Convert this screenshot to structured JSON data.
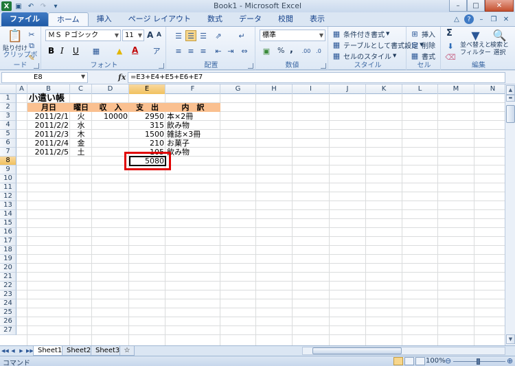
{
  "window": {
    "title": "Book1 - Microsoft Excel",
    "app_icon": "excel-icon",
    "controls": [
      "minimize-icon",
      "maximize-icon",
      "close-icon"
    ]
  },
  "quick_access": [
    "save-icon",
    "undo-icon",
    "redo-icon",
    "customize-qat-icon"
  ],
  "ribbon_tabs": [
    "ファイル",
    "ホーム",
    "挿入",
    "ページ レイアウト",
    "数式",
    "データ",
    "校閲",
    "表示"
  ],
  "active_tab": "ホーム",
  "ribbon": {
    "clipboard": {
      "label": "クリップボード",
      "paste": "貼り付け"
    },
    "font": {
      "label": "フォント",
      "font_name": "ＭＳ Ｐゴシック",
      "font_size": "11",
      "grow": "A",
      "shrink": "A",
      "bold": "B",
      "italic": "I",
      "underline": "U",
      "color_a": "A"
    },
    "alignment": {
      "label": "配置"
    },
    "number": {
      "label": "数値",
      "format": "標準",
      "percent": "%",
      "comma": ","
    },
    "styles": {
      "label": "スタイル",
      "conditional": "条件付き書式",
      "as_table": "テーブルとして書式設定",
      "cell_styles": "セルのスタイル"
    },
    "cells": {
      "label": "セル",
      "insert": "挿入",
      "delete": "削除",
      "format": "書式"
    },
    "editing": {
      "label": "編集",
      "sigma": "Σ",
      "sort_filter_1": "並べ替えと",
      "sort_filter_2": "フィルター",
      "find_1": "検索と",
      "find_2": "選択"
    }
  },
  "formula_bar": {
    "name_box": "E8",
    "fx": "fx",
    "formula": "=E3+E4+E5+E6+E7"
  },
  "columns": [
    "A",
    "B",
    "C",
    "D",
    "E",
    "F",
    "G",
    "H",
    "I",
    "J",
    "K",
    "L",
    "M",
    "N"
  ],
  "selected_column": "E",
  "rows": [
    "1",
    "2",
    "3",
    "4",
    "5",
    "6",
    "7",
    "8",
    "9",
    "10",
    "11",
    "12",
    "13",
    "14",
    "15",
    "16",
    "17",
    "18",
    "19",
    "20",
    "21",
    "22",
    "23",
    "24",
    "25",
    "26",
    "27"
  ],
  "selected_row": "8",
  "sheet": {
    "title": "小遣い帳",
    "headers": [
      "月日",
      "曜日",
      "収　入",
      "支　出",
      "内　訳"
    ],
    "rows": [
      {
        "date": "2011/2/1",
        "day": "火",
        "income": "10000",
        "expense": "2950",
        "detail": "本×2冊"
      },
      {
        "date": "2011/2/2",
        "day": "水",
        "income": "",
        "expense": "315",
        "detail": "飲み物"
      },
      {
        "date": "2011/2/3",
        "day": "木",
        "income": "",
        "expense": "1500",
        "detail": "雑誌×3冊"
      },
      {
        "date": "2011/2/4",
        "day": "金",
        "income": "",
        "expense": "210",
        "detail": "お菓子"
      },
      {
        "date": "2011/2/5",
        "day": "土",
        "income": "",
        "expense": "105",
        "detail": "飲み物"
      }
    ],
    "total": "5080",
    "header_fill": "#fac090",
    "highlight_color": "#e00000"
  },
  "sheet_tabs": [
    "Sheet1",
    "Sheet2",
    "Sheet3"
  ],
  "active_sheet": "Sheet1",
  "status": {
    "mode": "コマンド",
    "zoom": "100%"
  }
}
